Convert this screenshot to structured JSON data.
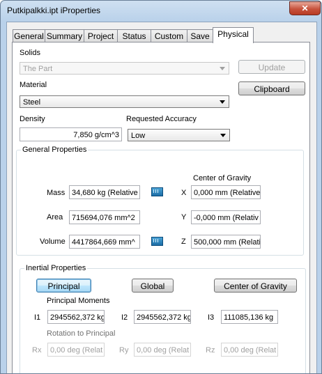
{
  "window": {
    "title": "Putkipalkki.ipt iProperties",
    "close_glyph": "✕"
  },
  "tabs": [
    "General",
    "Summary",
    "Project",
    "Status",
    "Custom",
    "Save",
    "Physical"
  ],
  "active_tab": "Physical",
  "physical": {
    "solids_label": "Solids",
    "solids_value": "The Part",
    "update_label": "Update",
    "material_label": "Material",
    "material_value": "Steel",
    "clipboard_label": "Clipboard",
    "density_label": "Density",
    "density_value": "7,850 g/cm^3",
    "accuracy_label": "Requested Accuracy",
    "accuracy_value": "Low"
  },
  "general_properties": {
    "title": "General Properties",
    "cog_label": "Center of Gravity",
    "mass_label": "Mass",
    "mass_value": "34,680 kg (Relative",
    "area_label": "Area",
    "area_value": "715694,076 mm^2",
    "volume_label": "Volume",
    "volume_value": "4417864,669 mm^",
    "x_label": "X",
    "x_value": "0,000 mm (Relative",
    "y_label": "Y",
    "y_value": "-0,000 mm (Relativ",
    "z_label": "Z",
    "z_value": "500,000 mm (Relati"
  },
  "inertial_properties": {
    "title": "Inertial Properties",
    "principal_label": "Principal",
    "global_label": "Global",
    "cog_button_label": "Center of Gravity",
    "principal_moments_label": "Principal Moments",
    "i1_label": "I1",
    "i1_value": "2945562,372 kg",
    "i2_label": "I2",
    "i2_value": "2945562,372 kg",
    "i3_label": "I3",
    "i3_value": "111085,136 kg",
    "rotation_label": "Rotation to Principal",
    "rx_label": "Rx",
    "rx_value": "0,00 deg (Relat",
    "ry_label": "Ry",
    "ry_value": "0,00 deg (Relat",
    "rz_label": "Rz",
    "rz_value": "0,00 deg (Relat"
  }
}
